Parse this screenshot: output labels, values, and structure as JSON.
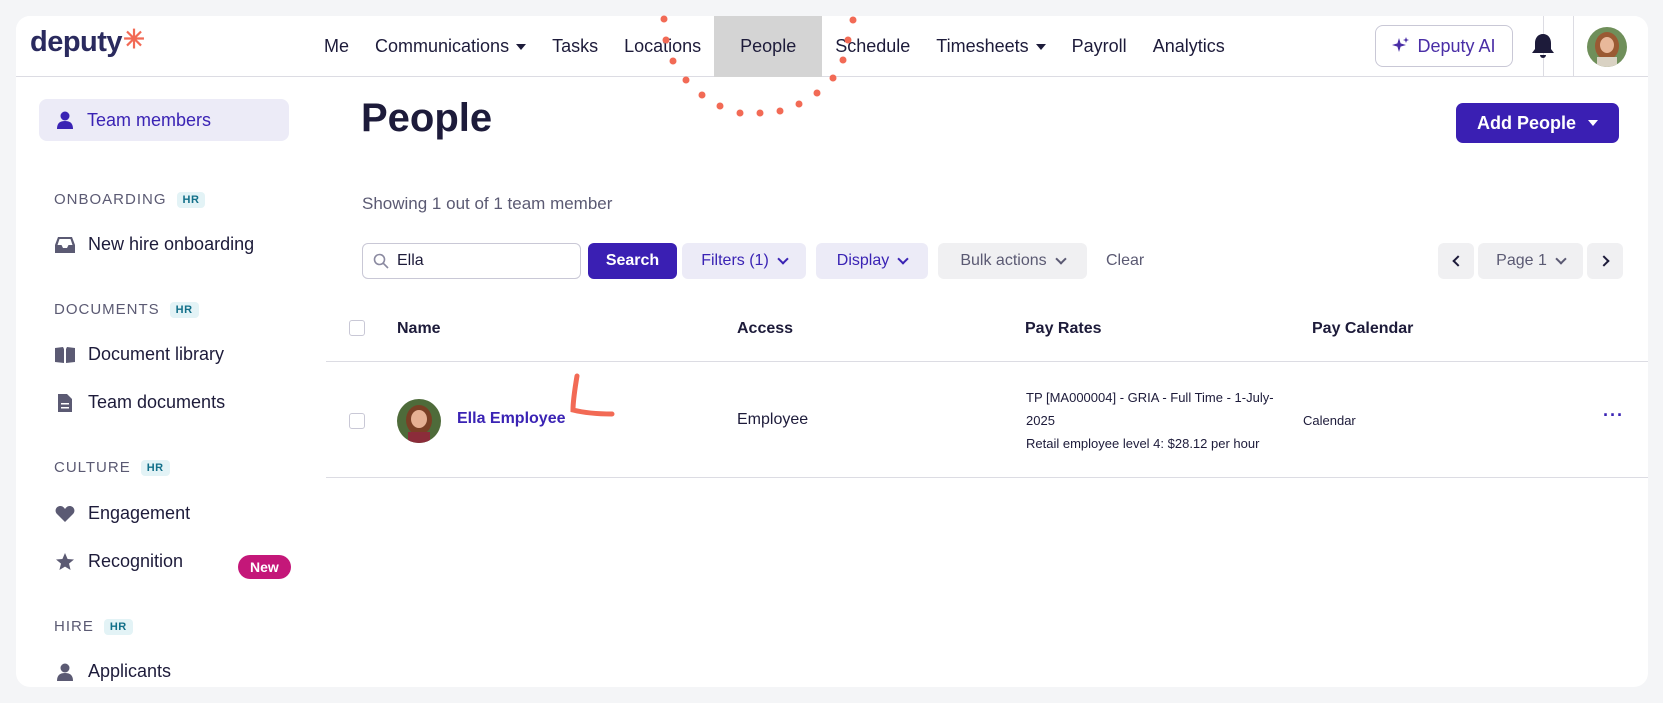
{
  "brand": {
    "name": "deputy",
    "mark": "✳"
  },
  "nav": {
    "items": [
      {
        "label": "Me",
        "dropdown": false
      },
      {
        "label": "Communications",
        "dropdown": true
      },
      {
        "label": "Tasks",
        "dropdown": false
      },
      {
        "label": "Locations",
        "dropdown": false
      },
      {
        "label": "People",
        "dropdown": false,
        "active": true
      },
      {
        "label": "Schedule",
        "dropdown": false
      },
      {
        "label": "Timesheets",
        "dropdown": true
      },
      {
        "label": "Payroll",
        "dropdown": false
      },
      {
        "label": "Analytics",
        "dropdown": false
      }
    ],
    "ai_label": "Deputy AI"
  },
  "sidebar": {
    "active_item": "Team members",
    "sections": [
      {
        "title": "ONBOARDING",
        "badge": "HR",
        "items": [
          "New hire onboarding"
        ]
      },
      {
        "title": "DOCUMENTS",
        "badge": "HR",
        "items": [
          "Document library",
          "Team documents"
        ]
      },
      {
        "title": "CULTURE",
        "badge": "HR",
        "items": [
          "Engagement",
          "Recognition"
        ]
      },
      {
        "title": "HIRE",
        "badge": "HR",
        "items": [
          "Applicants"
        ]
      }
    ],
    "new_badge": "New"
  },
  "main": {
    "title": "People",
    "add_button": "Add People",
    "showing": "Showing 1 out of 1 team member",
    "search": {
      "value": "Ella",
      "button": "Search"
    },
    "filters_label": "Filters (1)",
    "display_label": "Display",
    "bulk_label": "Bulk actions",
    "clear_label": "Clear",
    "page_label": "Page 1"
  },
  "table": {
    "columns": [
      "Name",
      "Access",
      "Pay Rates",
      "Pay Calendar"
    ],
    "rows": [
      {
        "name": "Ella Employee",
        "access": "Employee",
        "pay_rates": [
          "TP [MA000004] - GRIA - Full Time - 1-July-2025",
          "Retail employee level 4: $28.12 per hour"
        ],
        "pay_calendar": "Calendar",
        "more": "···"
      }
    ]
  },
  "colors": {
    "primary": "#3a1fb3",
    "accent": "#f26a55",
    "badge_new": "#c41779"
  }
}
